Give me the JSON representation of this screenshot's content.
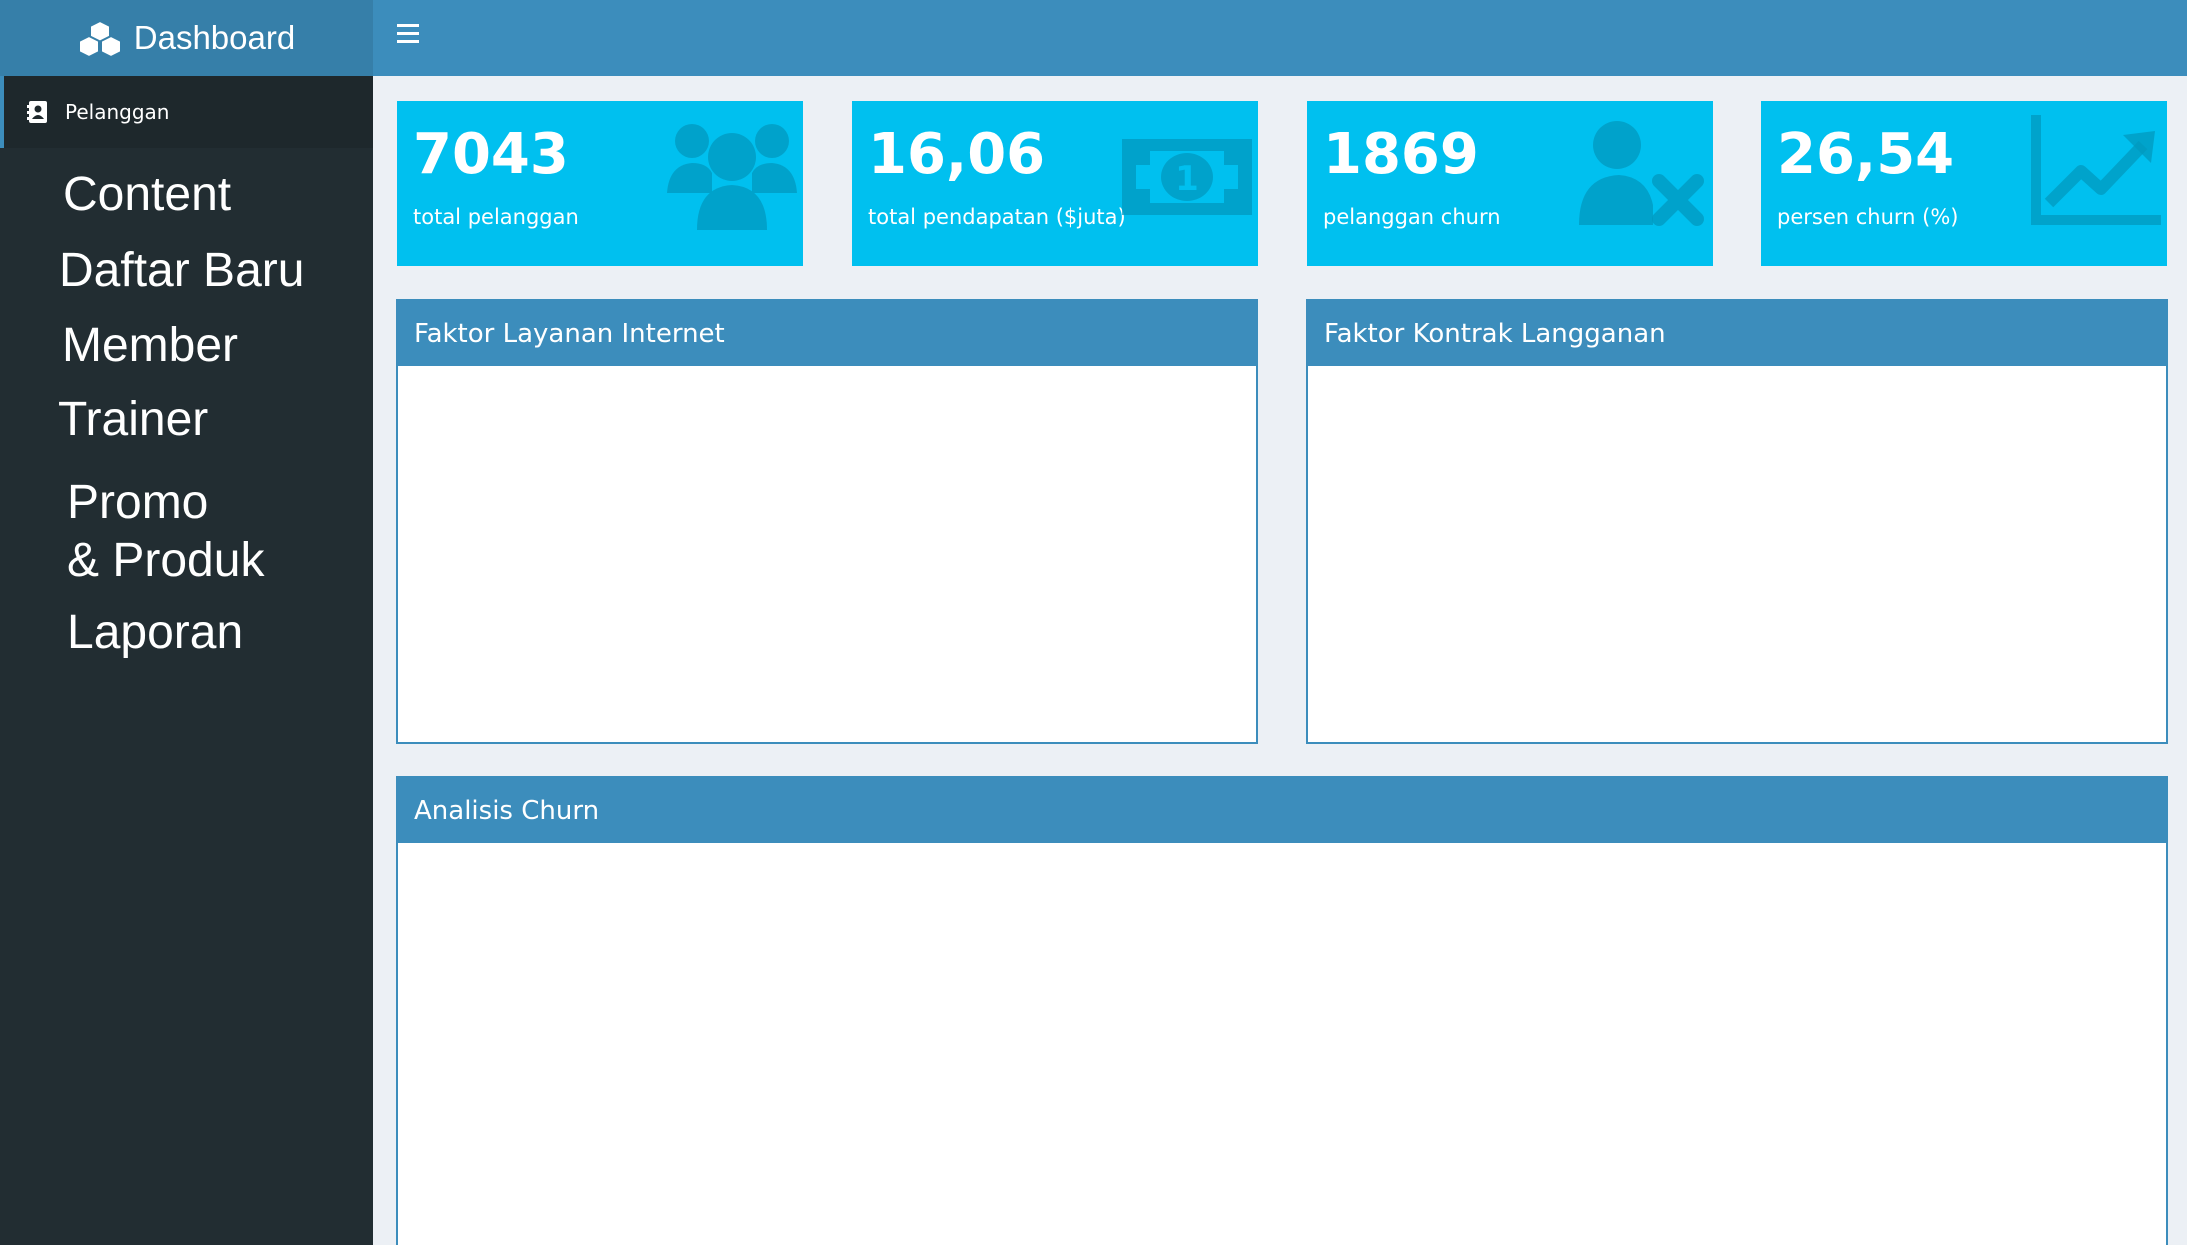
{
  "app": {
    "title": "Dashboard"
  },
  "sidebar": {
    "active_item": "Pelanggan",
    "items": [
      {
        "label": "Content"
      },
      {
        "label": "Daftar Baru"
      },
      {
        "label": "Member"
      },
      {
        "label": "Trainer"
      },
      {
        "label": "Promo\n& Produk"
      },
      {
        "label": "Laporan"
      }
    ]
  },
  "stats": [
    {
      "value": "7043",
      "label": "total pelanggan",
      "icon": "users-icon"
    },
    {
      "value": "16,06",
      "label": "total pendapatan ($juta)",
      "icon": "money-icon"
    },
    {
      "value": "1869",
      "label": "pelanggan churn",
      "icon": "user-times-icon"
    },
    {
      "value": "26,54",
      "label": "persen churn (%)",
      "icon": "line-chart-icon"
    }
  ],
  "panels": {
    "internet": {
      "title": "Faktor Layanan Internet"
    },
    "contract": {
      "title": "Faktor Kontrak Langganan"
    },
    "churn": {
      "title": "Analisis Churn"
    }
  },
  "colors": {
    "header": "#3c8dbc",
    "logo": "#367fa9",
    "sidebar": "#222d32",
    "infobox": "#00c0ef",
    "background": "#ecf0f5"
  }
}
